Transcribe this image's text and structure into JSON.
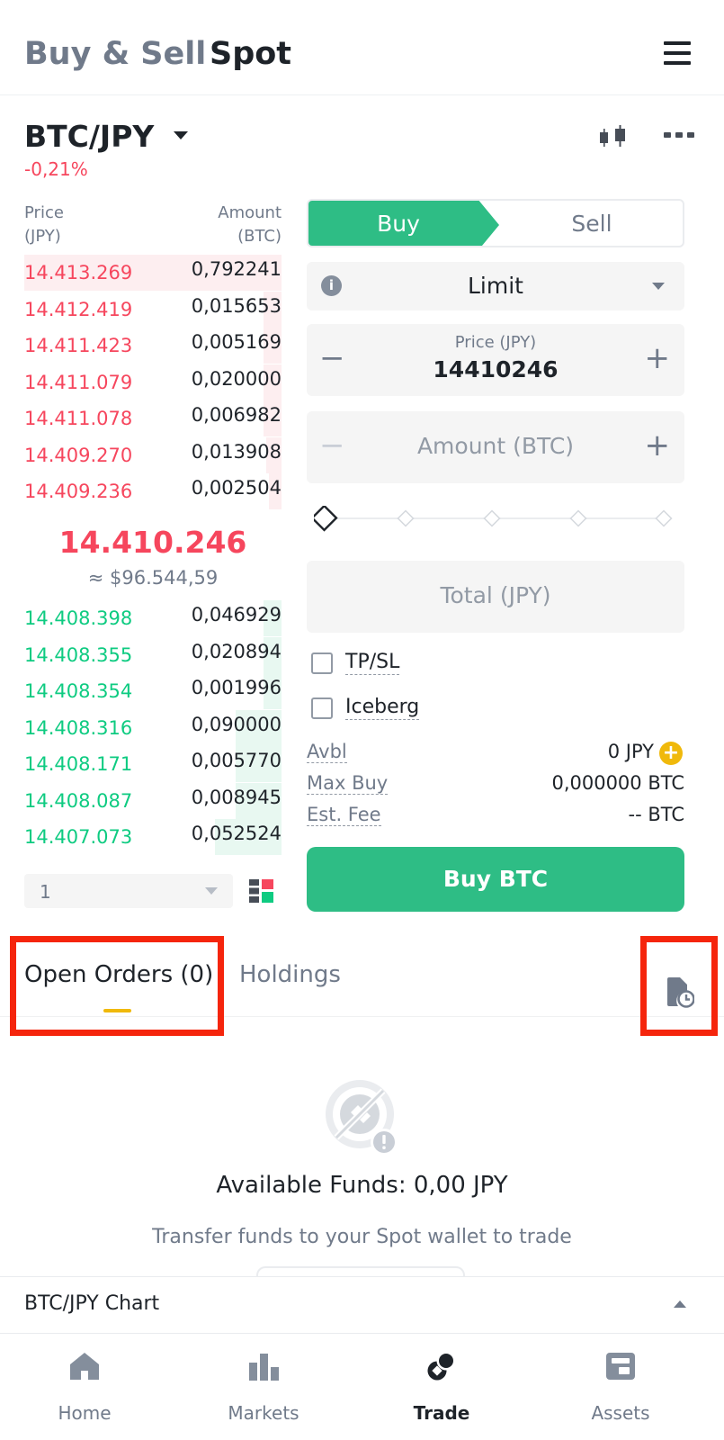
{
  "header": {
    "tabs": [
      {
        "label": "Buy & Sell",
        "active": false
      },
      {
        "label": "Spot",
        "active": true
      }
    ]
  },
  "pair": {
    "symbol": "BTC/JPY",
    "change": "-0,21%"
  },
  "order_book": {
    "price_header": [
      "Price",
      "(JPY)"
    ],
    "amount_header": [
      "Amount",
      "(BTC)"
    ],
    "asks": [
      {
        "price": "14.413.269",
        "amount": "0,792241",
        "depth": 1.0
      },
      {
        "price": "14.412.419",
        "amount": "0,015653",
        "depth": 0.07
      },
      {
        "price": "14.411.423",
        "amount": "0,005169",
        "depth": 0.07
      },
      {
        "price": "14.411.079",
        "amount": "0,020000",
        "depth": 0.07
      },
      {
        "price": "14.411.078",
        "amount": "0,006982",
        "depth": 0.07
      },
      {
        "price": "14.409.270",
        "amount": "0,013908",
        "depth": 0.06
      },
      {
        "price": "14.409.236",
        "amount": "0,002504",
        "depth": 0.05
      }
    ],
    "mid_price": "14.410.246",
    "mid_usd": "≈ $96.544,59",
    "bids": [
      {
        "price": "14.408.398",
        "amount": "0,046929",
        "depth": 0.07
      },
      {
        "price": "14.408.355",
        "amount": "0,020894",
        "depth": 0.07
      },
      {
        "price": "14.408.354",
        "amount": "0,001996",
        "depth": 0.07
      },
      {
        "price": "14.408.316",
        "amount": "0,090000",
        "depth": 0.18
      },
      {
        "price": "14.408.171",
        "amount": "0,005770",
        "depth": 0.18
      },
      {
        "price": "14.408.087",
        "amount": "0,008945",
        "depth": 0.18
      },
      {
        "price": "14.407.073",
        "amount": "0,052524",
        "depth": 0.26
      }
    ],
    "depth_value": "1"
  },
  "order_form": {
    "buy_label": "Buy",
    "sell_label": "Sell",
    "order_type": "Limit",
    "price_caption": "Price (JPY)",
    "price_value": "14410246",
    "amount_placeholder": "Amount (BTC)",
    "total_placeholder": "Total (JPY)",
    "slider_level": 0,
    "tpsl_label": "TP/SL",
    "iceberg_label": "Iceberg",
    "avbl_label": "Avbl",
    "avbl_value": "0 JPY",
    "maxbuy_label": "Max Buy",
    "maxbuy_value": "0,000000 BTC",
    "fee_label": "Est. Fee",
    "fee_value": "-- BTC",
    "submit_label": "Buy BTC"
  },
  "orders": {
    "tab_open": "Open Orders (0)",
    "tab_holdings": "Holdings",
    "empty_title": "Available Funds: 0,00 JPY",
    "empty_hint": "Transfer funds to your Spot wallet to trade"
  },
  "chart_bar": {
    "label": "BTC/JPY Chart"
  },
  "nav": {
    "items": [
      {
        "label": "Home",
        "icon": "home-icon",
        "active": false
      },
      {
        "label": "Markets",
        "icon": "markets-icon",
        "active": false
      },
      {
        "label": "Trade",
        "icon": "trade-icon",
        "active": true
      },
      {
        "label": "Assets",
        "icon": "assets-icon",
        "active": false
      }
    ]
  },
  "colors": {
    "ask": "#f6465d",
    "bid": "#0ecb81",
    "buy_button": "#2ebd85",
    "accent": "#f0b90b",
    "highlight_box": "#f5250c"
  }
}
